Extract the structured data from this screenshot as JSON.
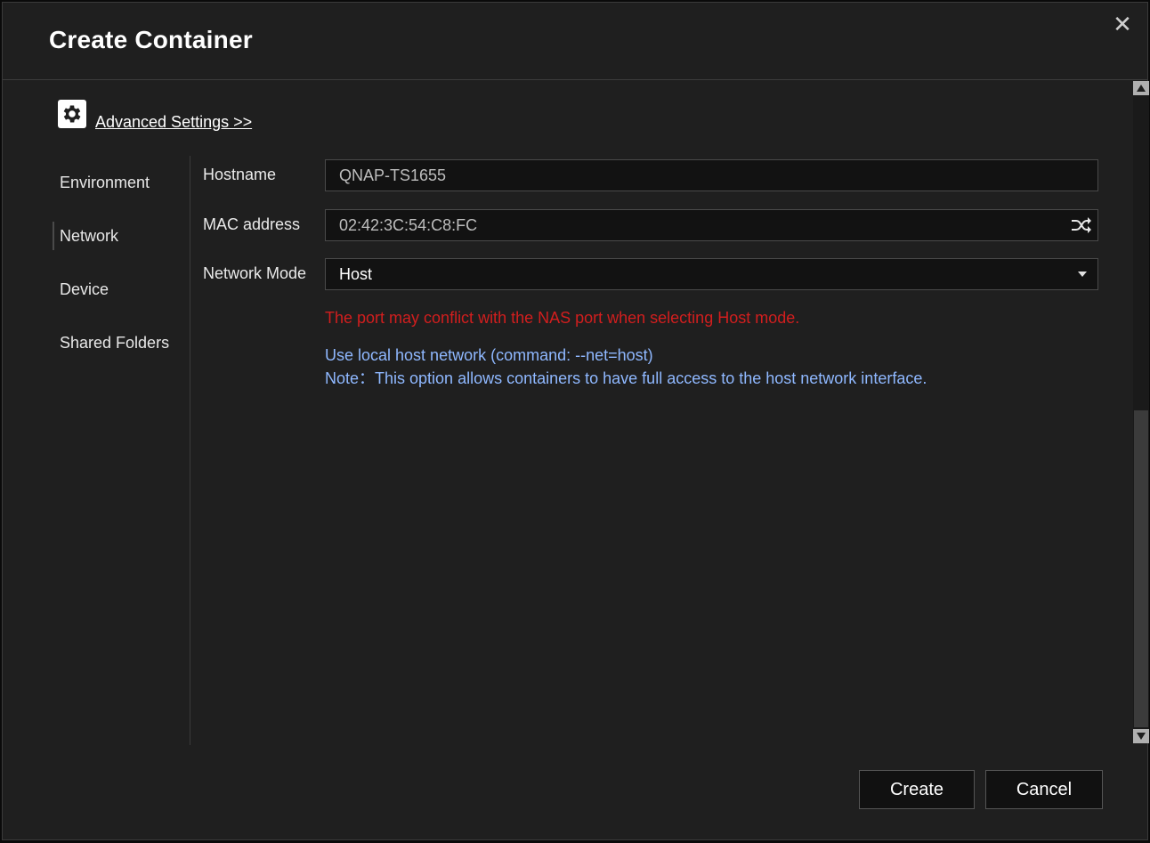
{
  "dialog": {
    "title": "Create Container",
    "close_label": "✕"
  },
  "advanced": {
    "icon": "gear-icon",
    "link_label": "Advanced Settings >>"
  },
  "sidebar": {
    "items": [
      {
        "label": "Environment"
      },
      {
        "label": "Network",
        "active": true
      },
      {
        "label": "Device"
      },
      {
        "label": "Shared Folders"
      }
    ]
  },
  "network": {
    "hostname_label": "Hostname",
    "hostname_value": "QNAP-TS1655",
    "mac_label": "MAC address",
    "mac_value": "02:42:3C:54:C8:FC",
    "mac_icon": "shuffle-icon",
    "mode_label": "Network Mode",
    "mode_value": "Host",
    "warning": "The port may conflict with the NAS port when selecting Host mode.",
    "info_line1": "Use local host network (command: --net=host)",
    "info_line2": "Note：This option allows containers to have full access to the host network interface."
  },
  "footer": {
    "create_label": "Create",
    "cancel_label": "Cancel"
  },
  "colors": {
    "warning": "#d21e1e",
    "info": "#8fb8ff",
    "background": "#1f1f1f"
  }
}
